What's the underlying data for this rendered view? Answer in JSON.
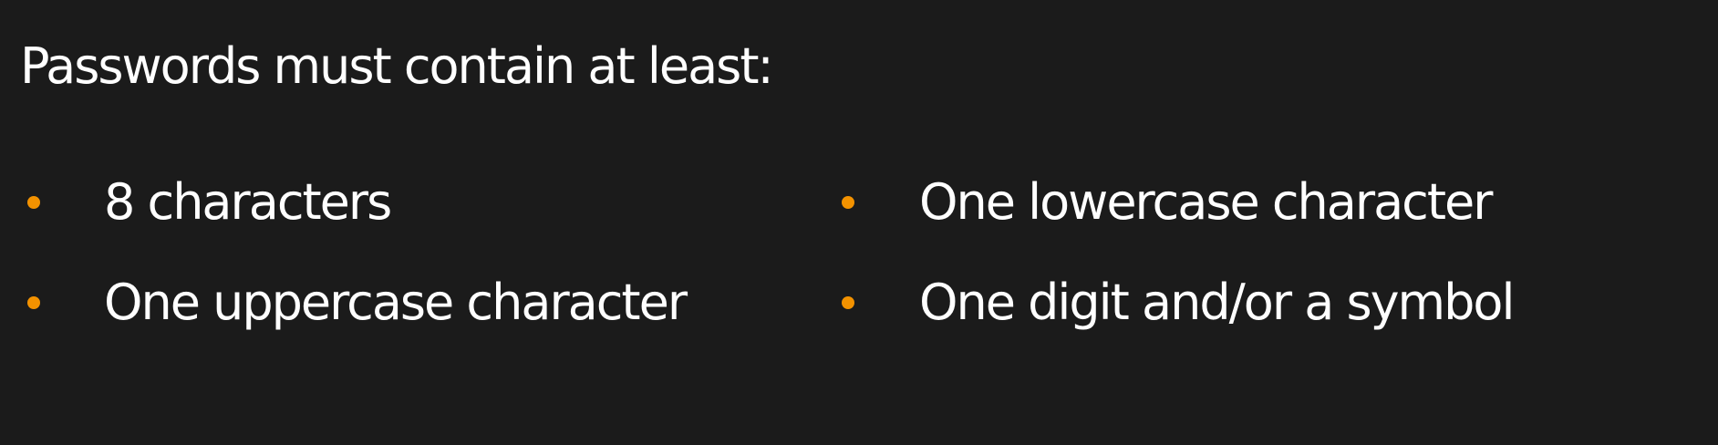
{
  "theme": {
    "background": "#1b1b1b",
    "text": "#ffffff",
    "bullet": "#f39200"
  },
  "password_rules": {
    "title": "Passwords must contain at least:",
    "items": [
      {
        "label": "8 characters",
        "icon": "bullet-dot-icon"
      },
      {
        "label": "One lowercase character",
        "icon": "bullet-dot-icon"
      },
      {
        "label": "One uppercase character",
        "icon": "bullet-dot-icon"
      },
      {
        "label": "One digit and/or a symbol",
        "icon": "bullet-dot-icon"
      }
    ]
  }
}
